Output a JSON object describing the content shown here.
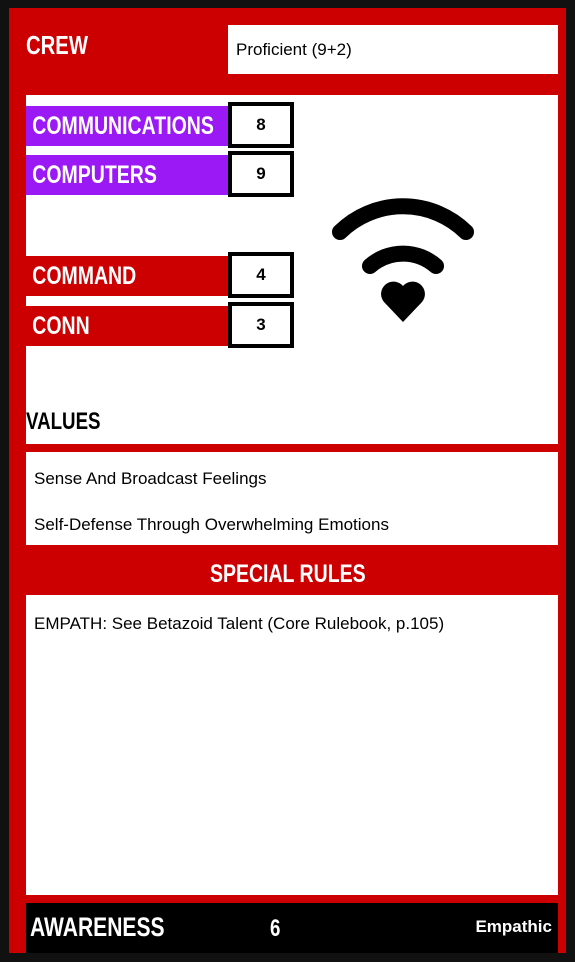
{
  "crew": {
    "label": "CREW",
    "value": "Proficient (9+2)"
  },
  "disciplines": [
    {
      "name": "COMMUNICATIONS",
      "score": "8",
      "color": "#9b19f5"
    },
    {
      "name": "COMPUTERS",
      "score": "9",
      "color": "#9b19f5"
    },
    {
      "name": "COMMAND",
      "score": "4",
      "color": "#cc0000"
    },
    {
      "name": "CONN",
      "score": "3",
      "color": "#cc0000"
    }
  ],
  "emblem": {
    "icon": "wifi-heart-icon"
  },
  "values": {
    "title": "VALUES",
    "items": [
      "Sense And Broadcast Feelings",
      "Self-Defense Through Overwhelming Emotions"
    ]
  },
  "special_rules": {
    "title": "SPECIAL RULES",
    "items": [
      "EMPATH: See Betazoid Talent (Core Rulebook, p.105)"
    ]
  },
  "footer": {
    "attribute": "AWARENESS",
    "score": "6",
    "trait": "Empathic"
  },
  "colors": {
    "card": "#cc0000",
    "accent": "#9b19f5",
    "border": "#111111"
  }
}
